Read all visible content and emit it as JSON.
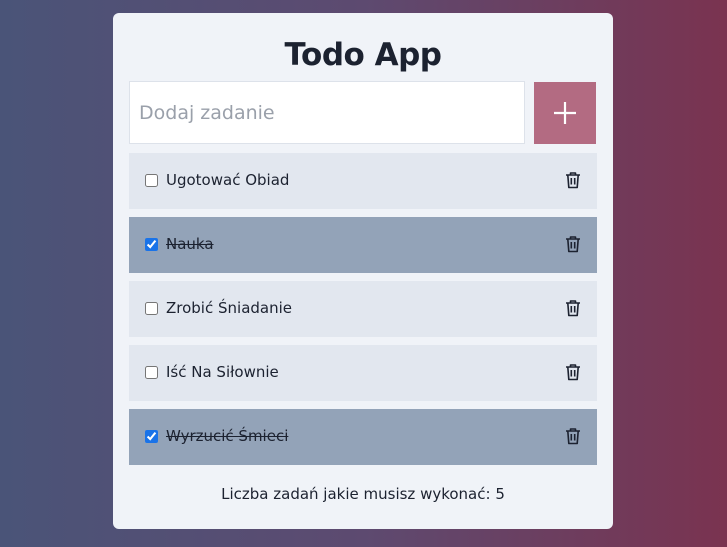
{
  "app": {
    "title": "Todo App"
  },
  "new_task": {
    "placeholder": "Dodaj zadanie",
    "value": ""
  },
  "add_button": {
    "icon": "plus-icon"
  },
  "tasks": [
    {
      "label": "Ugotować Obiad",
      "done": false
    },
    {
      "label": "Nauka",
      "done": true
    },
    {
      "label": "Zrobić Śniadanie",
      "done": false
    },
    {
      "label": "Iść Na Siłownie",
      "done": false
    },
    {
      "label": "Wyrzucić Śmieci",
      "done": true
    }
  ],
  "footer": {
    "text": "Liczba zadań jakie musisz wykonać: 5"
  },
  "colors": {
    "accent": "#b36b82",
    "item_bg": "#e2e7ef",
    "item_done_bg": "#93a3b8",
    "card_bg": "#f0f3f8"
  }
}
